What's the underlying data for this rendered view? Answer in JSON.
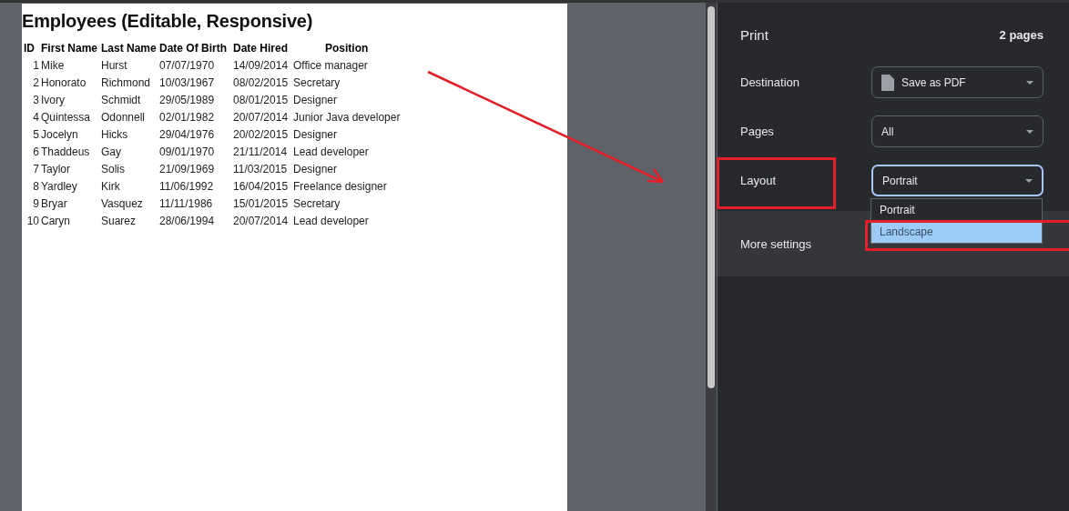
{
  "preview": {
    "title": "Employees (Editable, Responsive)",
    "columns": [
      "ID",
      "First Name",
      "Last Name",
      "Date Of Birth",
      "Date Hired",
      "Position"
    ],
    "rows": [
      [
        "1",
        "Mike",
        "Hurst",
        "07/07/1970",
        "14/09/2014",
        "Office manager"
      ],
      [
        "2",
        "Honorato",
        "Richmond",
        "10/03/1967",
        "08/02/2015",
        "Secretary"
      ],
      [
        "3",
        "Ivory",
        "Schmidt",
        "29/05/1989",
        "08/01/2015",
        "Designer"
      ],
      [
        "4",
        "Quintessa",
        "Odonnell",
        "02/01/1982",
        "20/07/2014",
        "Junior Java developer"
      ],
      [
        "5",
        "Jocelyn",
        "Hicks",
        "29/04/1976",
        "20/02/2015",
        "Designer"
      ],
      [
        "6",
        "Thaddeus",
        "Gay",
        "09/01/1970",
        "21/11/2014",
        "Lead developer"
      ],
      [
        "7",
        "Taylor",
        "Solis",
        "21/09/1969",
        "11/03/2015",
        "Designer"
      ],
      [
        "8",
        "Yardley",
        "Kirk",
        "11/06/1992",
        "16/04/2015",
        "Freelance designer"
      ],
      [
        "9",
        "Bryar",
        "Vasquez",
        "11/11/1986",
        "15/01/2015",
        "Secretary"
      ],
      [
        "10",
        "Caryn",
        "Suarez",
        "28/06/1994",
        "20/07/2014",
        "Lead developer"
      ]
    ]
  },
  "print": {
    "title": "Print",
    "page_count": "2 pages",
    "settings": [
      {
        "label": "Destination",
        "value": "Save as PDF",
        "kind": "file",
        "focused": false
      },
      {
        "label": "Pages",
        "value": "All",
        "kind": "plain",
        "focused": false
      },
      {
        "label": "Layout",
        "value": "Portrait",
        "kind": "plain",
        "focused": true
      }
    ],
    "layout_options": [
      {
        "label": "Portrait",
        "selected": false
      },
      {
        "label": "Landscape",
        "selected": true
      }
    ],
    "more_settings": "More settings"
  }
}
